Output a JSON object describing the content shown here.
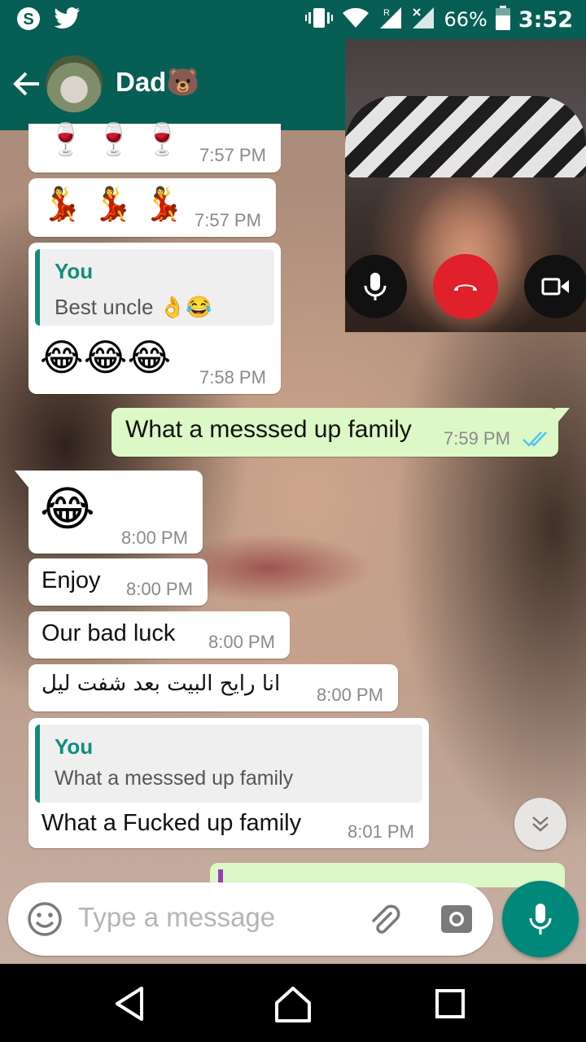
{
  "status_bar": {
    "battery": "66%",
    "time": "3:52",
    "left_icons": [
      "skype-icon",
      "twitter-icon"
    ],
    "right_icons": [
      "vibrate-icon",
      "wifi-icon",
      "signal-icon",
      "signal-icon"
    ]
  },
  "header": {
    "contact_name": "Dad🐻"
  },
  "messages": {
    "m1": {
      "emoji": "🍷 🍷 🍷",
      "time": "7:57 PM"
    },
    "m2": {
      "emoji": "💃 💃 💃",
      "time": "7:57 PM"
    },
    "m3": {
      "quote_author": "You",
      "quote_text": "Best uncle 👌😂",
      "emoji": "😂😂😂",
      "time": "7:58 PM"
    },
    "m4": {
      "text": "What a messsed up family",
      "time": "7:59 PM"
    },
    "m5": {
      "emoji": "😂",
      "time": "8:00 PM"
    },
    "m6": {
      "text": "Enjoy",
      "time": "8:00 PM"
    },
    "m7": {
      "text": "Our bad luck",
      "time": "8:00 PM"
    },
    "m8": {
      "text": "انا رايح البيت بعد شفت ليل",
      "time": "8:00 PM"
    },
    "m9": {
      "quote_author": "You",
      "quote_text": "What a messsed up family",
      "text": "What a Fucked up family",
      "time": "8:01 PM"
    }
  },
  "input": {
    "placeholder": "Type a message"
  },
  "colors": {
    "primary": "#075e54",
    "outgoing_bubble": "#dcf8c6",
    "accent": "#128c7e",
    "fab": "#00897b",
    "end_call": "#e0202b",
    "read_tick": "#4fc3f7"
  }
}
